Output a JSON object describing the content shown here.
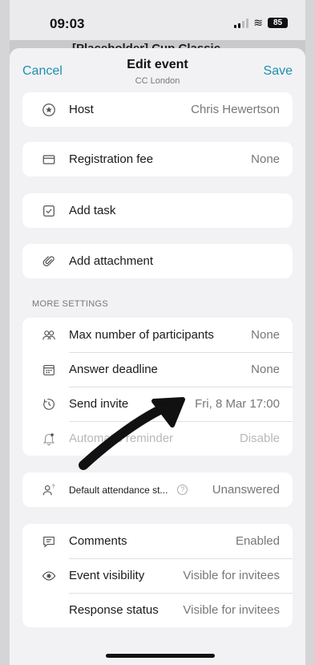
{
  "status_bar": {
    "time": "09:03",
    "battery": "85"
  },
  "behind_title": "[Placeholder] Cup Classic",
  "nav": {
    "cancel": "Cancel",
    "title": "Edit event",
    "subtitle": "CC London",
    "save": "Save"
  },
  "host": {
    "label": "Host",
    "value": "Chris Hewertson"
  },
  "registration_fee": {
    "label": "Registration fee",
    "value": "None"
  },
  "add_task": {
    "label": "Add task"
  },
  "add_attachment": {
    "label": "Add attachment"
  },
  "more_settings": {
    "header": "MORE SETTINGS",
    "items": [
      {
        "label": "Max number of participants",
        "value": "None"
      },
      {
        "label": "Answer deadline",
        "value": "None"
      },
      {
        "label": "Send invite",
        "value": "Fri, 8 Mar  17:00"
      },
      {
        "label": "Automatic reminder",
        "value": "Disable"
      }
    ]
  },
  "default_attendance": {
    "label": "Default attendance st...",
    "value": "Unanswered"
  },
  "visibility": {
    "items": [
      {
        "label": "Comments",
        "value": "Enabled"
      },
      {
        "label": "Event visibility",
        "value": "Visible for invitees"
      },
      {
        "label": "Response status",
        "value": "Visible for invitees"
      }
    ]
  }
}
